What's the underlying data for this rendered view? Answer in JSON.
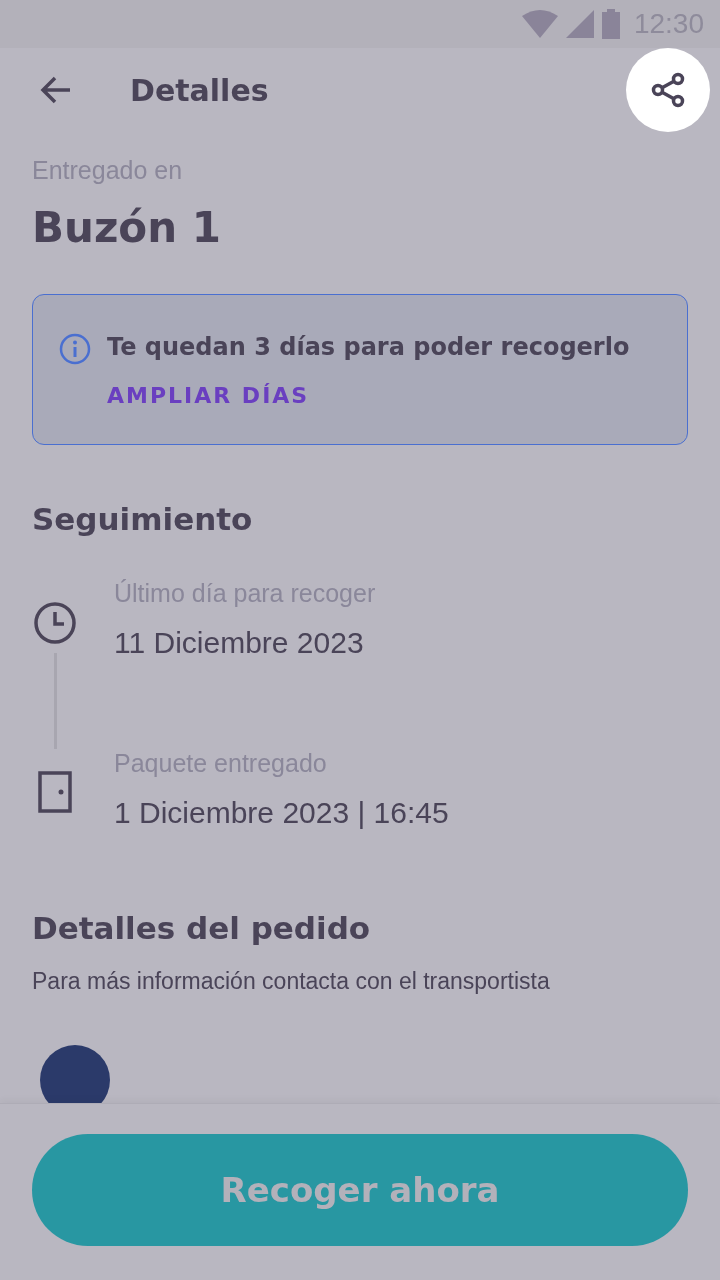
{
  "status_bar": {
    "time": "12:30"
  },
  "header": {
    "title": "Detalles"
  },
  "delivery": {
    "label": "Entregado en",
    "place": "Buzón 1"
  },
  "notice": {
    "text": "Te quedan 3 días para poder recogerlo",
    "action": "AMPLIAR DÍAS"
  },
  "tracking": {
    "title": "Seguimiento",
    "events": [
      {
        "kind": "clock",
        "label": "Último día para recoger",
        "value": "11 Diciembre 2023"
      },
      {
        "kind": "door",
        "label": "Paquete entregado",
        "value": "1 Diciembre 2023 | 16:45"
      }
    ]
  },
  "order": {
    "title": "Detalles del pedido",
    "subtitle": "Para más información contacta con el transportista"
  },
  "primary_button": {
    "label": "Recoger ahora"
  }
}
